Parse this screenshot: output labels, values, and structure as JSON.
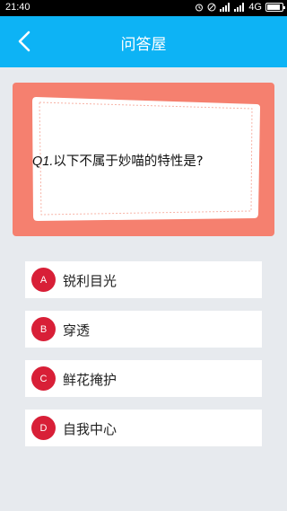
{
  "status_bar": {
    "time": "21:40",
    "network": "4G"
  },
  "header": {
    "title": "问答屋",
    "back_icon": "chevron-left-icon"
  },
  "question": {
    "number": "Q1.",
    "text": "以下不属于妙喵的特性是?"
  },
  "options": [
    {
      "letter": "A",
      "label": "锐利目光"
    },
    {
      "letter": "B",
      "label": "穿透"
    },
    {
      "letter": "C",
      "label": "鲜花掩护"
    },
    {
      "letter": "D",
      "label": "自我中心"
    }
  ],
  "colors": {
    "header": "#0db3f5",
    "card": "#f5806f",
    "badge": "#d81f37",
    "background": "#e7eaee"
  }
}
